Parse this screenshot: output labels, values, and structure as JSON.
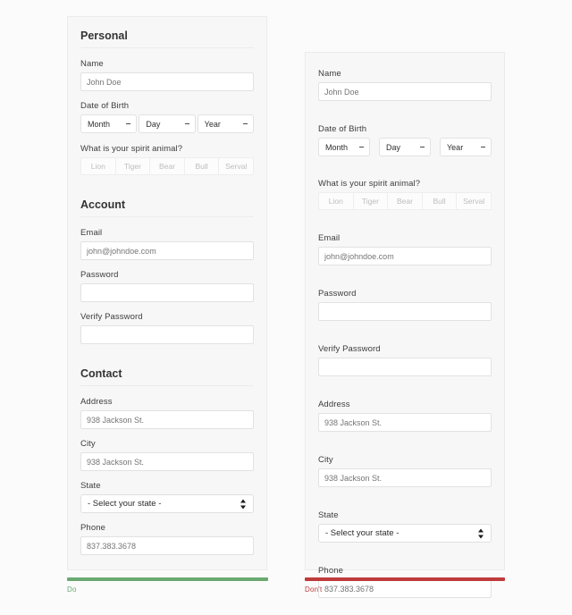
{
  "page": {
    "background_color": "#fbfbfb",
    "panel_background": "#f7f7f7",
    "panel_border": "#ebebeb"
  },
  "do_panel": {
    "sections": [
      {
        "heading": "Personal",
        "fields": [
          {
            "type": "text",
            "label": "Name",
            "placeholder": "John Doe"
          },
          {
            "type": "selects",
            "label": "Date of Birth",
            "options": [
              "Month",
              "Day",
              "Year"
            ]
          },
          {
            "type": "segment",
            "label": "What is your spirit animal?",
            "options": [
              "Lion",
              "Tiger",
              "Bear",
              "Bull",
              "Serval"
            ]
          }
        ]
      },
      {
        "heading": "Account",
        "fields": [
          {
            "type": "text",
            "label": "Email",
            "placeholder": "john@johndoe.com"
          },
          {
            "type": "text",
            "label": "Password",
            "placeholder": ""
          },
          {
            "type": "text",
            "label": "Verify Password",
            "placeholder": ""
          }
        ]
      },
      {
        "heading": "Contact",
        "fields": [
          {
            "type": "text",
            "label": "Address",
            "placeholder": "938 Jackson St."
          },
          {
            "type": "text",
            "label": "City",
            "placeholder": "938 Jackson St."
          },
          {
            "type": "state",
            "label": "State",
            "value": "- Select your state -"
          },
          {
            "type": "text",
            "label": "Phone",
            "placeholder": "837.383.3678"
          }
        ]
      }
    ]
  },
  "dont_panel": {
    "fields": [
      {
        "type": "text",
        "label": "Name",
        "placeholder": "John Doe"
      },
      {
        "type": "selects",
        "label": "Date of Birth",
        "options": [
          "Month",
          "Day",
          "Year"
        ]
      },
      {
        "type": "segment",
        "label": "What is your spirit animal?",
        "options": [
          "Lion",
          "Tiger",
          "Bear",
          "Bull",
          "Serval"
        ]
      },
      {
        "type": "text",
        "label": "Email",
        "placeholder": "john@johndoe.com"
      },
      {
        "type": "text",
        "label": "Password",
        "placeholder": ""
      },
      {
        "type": "text",
        "label": "Verify Password",
        "placeholder": ""
      },
      {
        "type": "text",
        "label": "Address",
        "placeholder": "938 Jackson St."
      },
      {
        "type": "text",
        "label": "City",
        "placeholder": "938 Jackson St."
      },
      {
        "type": "state",
        "label": "State",
        "value": "- Select your state -"
      },
      {
        "type": "text",
        "label": "Phone",
        "placeholder": "837.383.3678"
      }
    ]
  },
  "verdicts": {
    "do": {
      "caption": "Do",
      "color": "#6aa971"
    },
    "dont": {
      "caption": "Don't",
      "color": "#bf3b3b"
    }
  }
}
